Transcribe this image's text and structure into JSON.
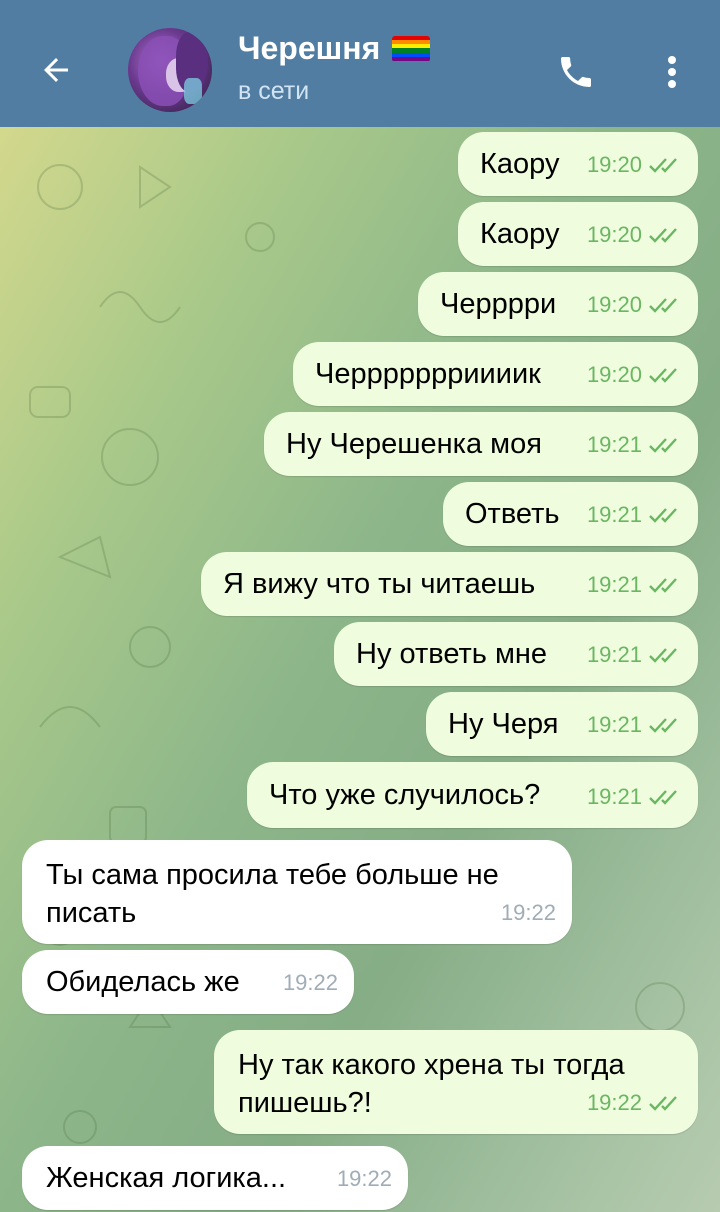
{
  "header": {
    "contact_name": "Черешня",
    "status": "в сети"
  },
  "colors": {
    "header_bg": "#517da2",
    "outgoing_bubble": "#effdde",
    "incoming_bubble": "#ffffff",
    "read_check": "#6bb663"
  },
  "icons": {
    "back": "arrow-left-icon",
    "call": "phone-icon",
    "menu": "more-vertical-icon",
    "flag": "rainbow-flag-icon",
    "read": "double-check-icon"
  },
  "messages": [
    {
      "dir": "out",
      "text": "Каору",
      "time": "19:20"
    },
    {
      "dir": "out",
      "text": "Каору",
      "time": "19:20"
    },
    {
      "dir": "out",
      "text": "Черррри",
      "time": "19:20"
    },
    {
      "dir": "out",
      "text": "Черрррррриииик",
      "time": "19:20"
    },
    {
      "dir": "out",
      "text": "Ну Черешенка моя",
      "time": "19:21"
    },
    {
      "dir": "out",
      "text": "Ответь",
      "time": "19:21"
    },
    {
      "dir": "out",
      "text": "Я вижу что ты читаешь",
      "time": "19:21"
    },
    {
      "dir": "out",
      "text": "Ну ответь мне",
      "time": "19:21"
    },
    {
      "dir": "out",
      "text": "Ну Черя",
      "time": "19:21"
    },
    {
      "dir": "out",
      "text": "Что уже случилось?",
      "time": "19:21"
    },
    {
      "dir": "in",
      "text": "Ты сама просила тебе больше не писать",
      "time": "19:22"
    },
    {
      "dir": "in",
      "text": "Обиделась же",
      "time": "19:22"
    },
    {
      "dir": "out",
      "text": "Ну так какого хрена ты тогда пишешь?!",
      "time": "19:22"
    },
    {
      "dir": "in",
      "text": "Женская логика...",
      "time": "19:22"
    }
  ]
}
